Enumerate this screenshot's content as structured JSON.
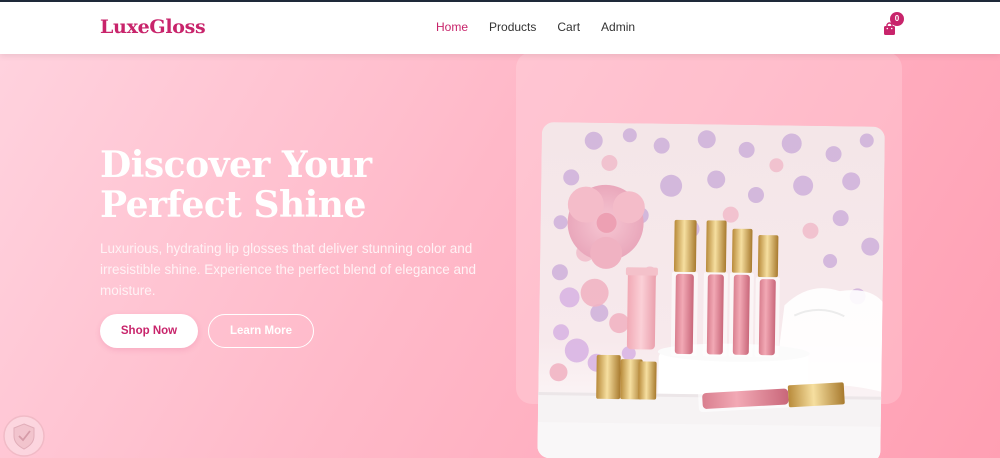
{
  "navbar": {
    "brand": "LuxeGloss",
    "links": [
      {
        "label": "Home",
        "active": true
      },
      {
        "label": "Products",
        "active": false
      },
      {
        "label": "Cart",
        "active": false
      },
      {
        "label": "Admin",
        "active": false
      }
    ],
    "cart": {
      "icon": "shopping-bag-icon",
      "count": "0"
    }
  },
  "hero": {
    "title_line1": "Discover Your",
    "title_line2": "Perfect Shine",
    "description": "Luxurious, hydrating lip glosses that deliver stunning color and irresistible shine. Experience the perfect blend of elegance and moisture.",
    "primary_button": "Shop Now",
    "secondary_button": "Learn More",
    "image": {
      "subject": "lip-gloss-product-image",
      "icon": "image"
    }
  },
  "colors": {
    "accent": "#c8246b",
    "hero_start": "#ffd2de",
    "hero_end": "#ff9fb3",
    "navbar_bg": "#ffffff"
  }
}
